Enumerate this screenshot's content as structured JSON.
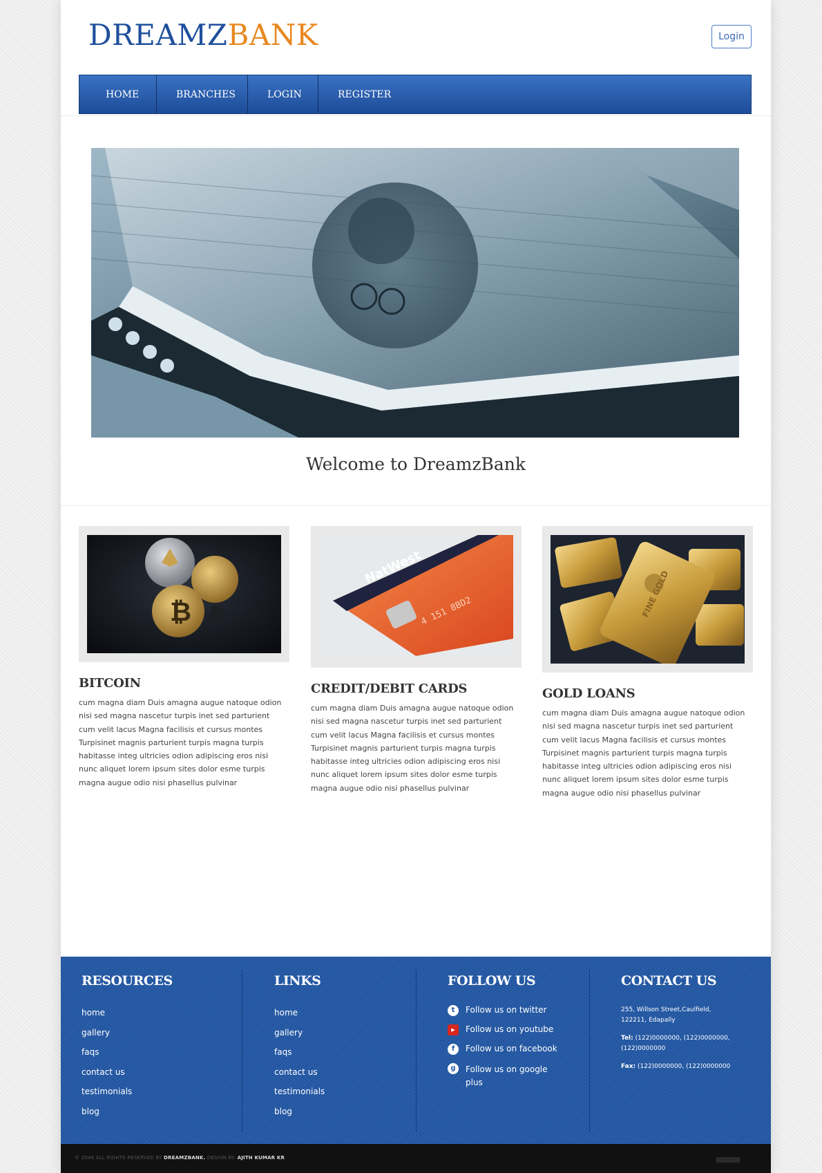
{
  "header": {
    "logo_part1": "DREAMZ",
    "logo_part2": "BANK",
    "login_button": "Login"
  },
  "nav": {
    "items": [
      "HOME",
      "BRANCHES",
      "LOGIN",
      "REGISTER"
    ]
  },
  "welcome": "Welcome to DreamzBank",
  "cards": [
    {
      "title": "BITCOIN",
      "text": "cum magna diam Duis amagna augue natoque odion nisi sed magna nascetur turpis inet sed parturient cum velit lacus Magna facilisis et cursus montes Turpisinet magnis parturient turpis magna turpis habitasse integ ultricies odion adipiscing eros nisi nunc aliquet lorem ipsum sites dolor esme turpis magna augue odio nisi phasellus pulvinar"
    },
    {
      "title": "CREDIT/DEBIT CARDS",
      "text": "cum magna diam Duis amagna augue natoque odion nisi sed magna nascetur turpis inet sed parturient cum velit lacus Magna facilisis et cursus montes Turpisinet magnis parturient turpis magna turpis habitasse integ ultricies odion adipiscing eros nisi nunc aliquet lorem ipsum sites dolor esme turpis magna augue odio nisi phasellus pulvinar"
    },
    {
      "title": "GOLD LOANS",
      "text": "cum magna diam Duis amagna augue natoque odion nisi sed magna nascetur turpis inet sed parturient cum velit lacus Magna facilisis et cursus montes Turpisinet magnis parturient turpis magna turpis habitasse integ ultricies odion adipiscing eros nisi nunc aliquet lorem ipsum sites dolor esme turpis magna augue odio nisi phasellus pulvinar"
    }
  ],
  "footer": {
    "resources": {
      "title": "RESOURCES",
      "items": [
        "home",
        "gallery",
        "faqs",
        "contact us",
        "testimonials",
        "blog"
      ]
    },
    "links": {
      "title": "LINKS",
      "items": [
        "home",
        "gallery",
        "faqs",
        "contact us",
        "testimonials",
        "blog"
      ]
    },
    "follow": {
      "title": "FOLLOW US",
      "items": [
        {
          "icon": "twitter-icon",
          "label": "Follow us on twitter"
        },
        {
          "icon": "youtube-icon",
          "label": "Follow us on youtube"
        },
        {
          "icon": "facebook-icon",
          "label": "Follow us on facebook"
        },
        {
          "icon": "google-plus-icon",
          "label": "Follow us on google plus"
        }
      ]
    },
    "contact": {
      "title": "CONTACT US",
      "address": "255, Willson Street,Caulfield, 122211, Edapally",
      "tel_label": "Tel:",
      "tel": "(122)0000000, (122)0000000, (122)0000000",
      "fax_label": "Fax:",
      "fax": "(122)0000000, (122)0000000"
    }
  },
  "copyright": {
    "prefix": "© 2046 ALL RIGHTS RESERVED BY",
    "brand": "DREAMZBANK.",
    "design_by": "DESIGN BY:",
    "designer": "AJITH KUMAR KR"
  },
  "colors": {
    "brand_blue": "#1e4f9c",
    "brand_orange": "#e8871e",
    "nav_blue": "#2b62b4",
    "footer_blue": "#2358a4"
  }
}
